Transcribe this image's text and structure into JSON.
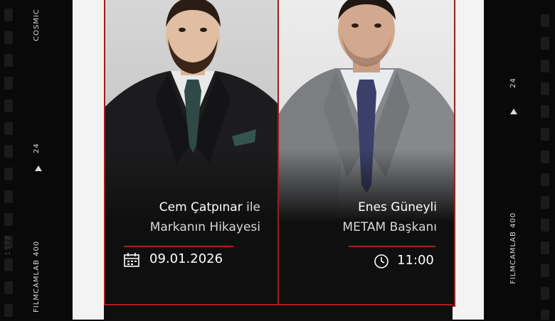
{
  "film": {
    "left_top_label": "COSMIC",
    "left_frame": "24",
    "left_brand": "FILMCAMLAB 400",
    "left_faint_num": "1578",
    "right_frame": "24",
    "right_brand": "FILMCAMLAB 400"
  },
  "speakers": [
    {
      "name": "Cem Çatpınar",
      "name_suffix": " ile",
      "subtitle": "Markanın Hikayesi",
      "detail": "09.01.2026",
      "detail_icon": "calendar-icon"
    },
    {
      "name": "Enes Güneyli",
      "name_suffix": "",
      "subtitle": "METAM Başkanı",
      "detail": "11:00",
      "detail_icon": "clock-icon"
    }
  ],
  "colors": {
    "accent_red": "#b01e1e",
    "card_bg": "#0f0f0f",
    "poster_bg": "#f3f3f3"
  }
}
